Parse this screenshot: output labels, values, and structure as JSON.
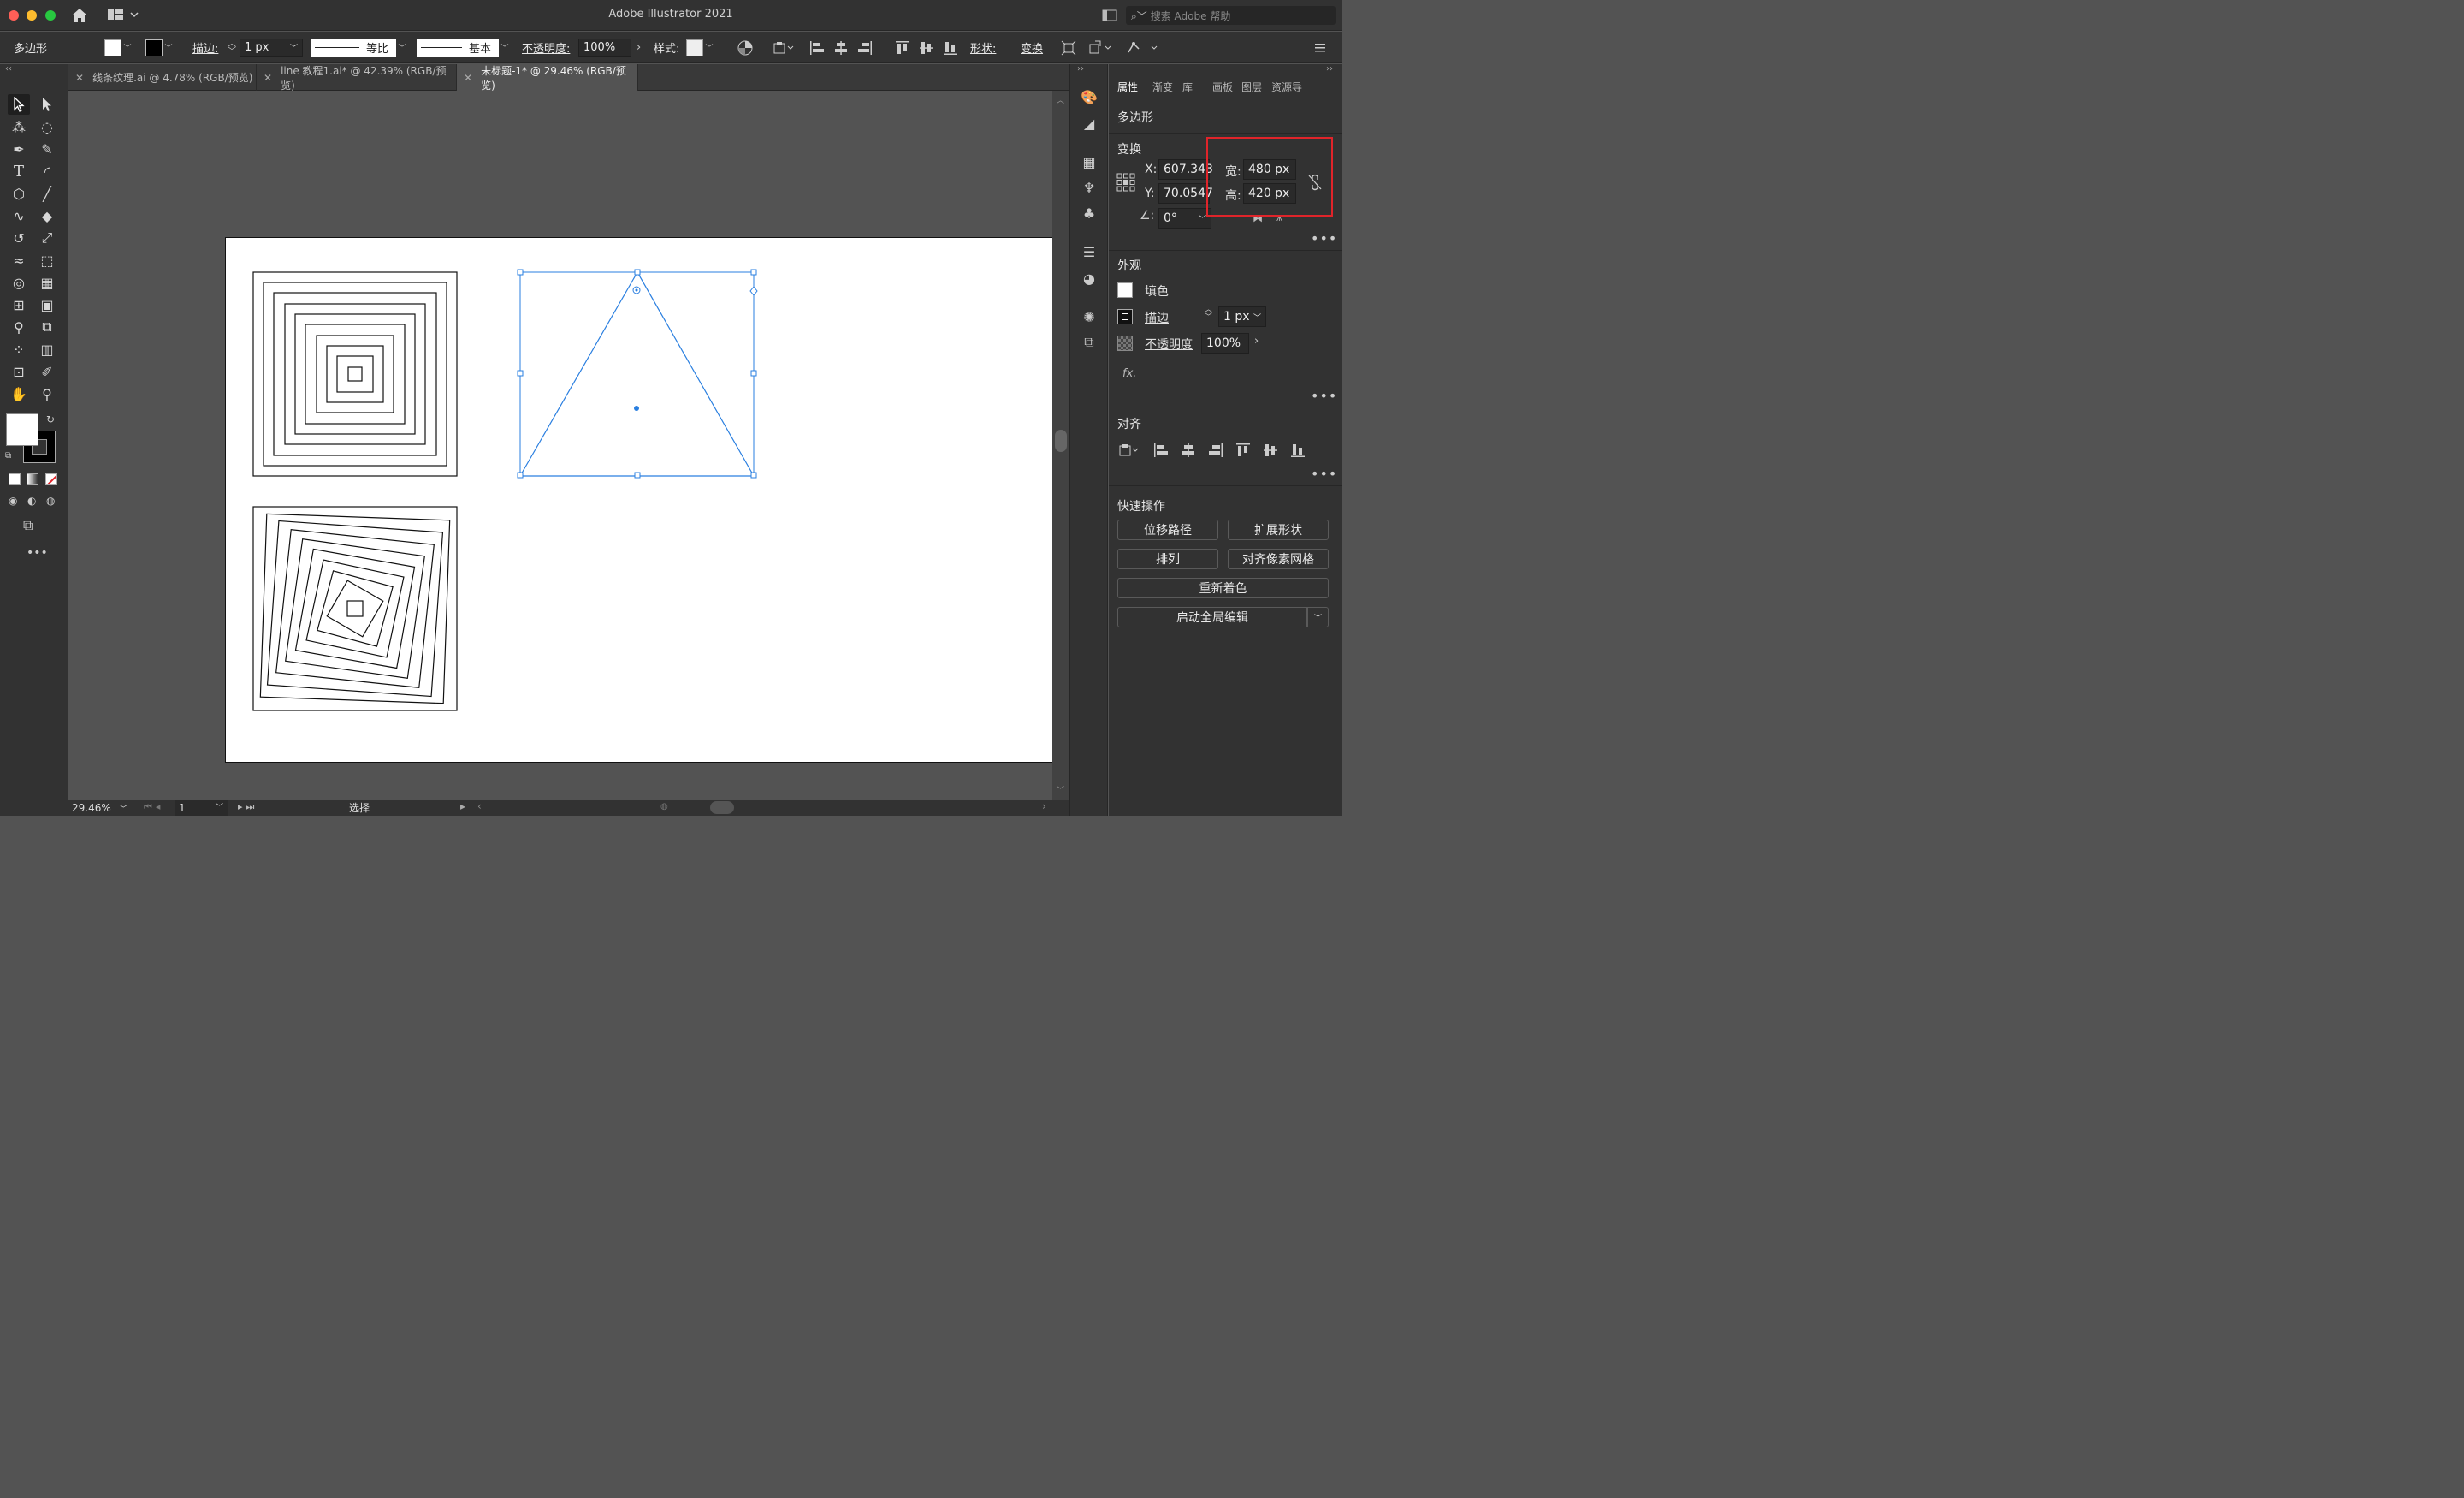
{
  "window": {
    "title": "Adobe Illustrator 2021",
    "search_placeholder": "搜索 Adobe 帮助"
  },
  "controlbar": {
    "object_type": "多边形",
    "stroke_label": "描边:",
    "stroke_weight": "1 px",
    "profile_label": "等比",
    "brush_label": "基本",
    "opacity_label": "不透明度:",
    "opacity_value": "100%",
    "style_label": "样式:",
    "shape_label": "形状:",
    "transform_label": "变换"
  },
  "tabs": [
    {
      "label": "线条纹理.ai @ 4.78% (RGB/预览)",
      "active": false
    },
    {
      "label": "line 教程1.ai* @ 42.39% (RGB/预览)",
      "active": false
    },
    {
      "label": "未标题-1* @ 29.46% (RGB/预览)",
      "active": true
    }
  ],
  "statusbar": {
    "zoom": "29.46%",
    "artboard_number": "1",
    "mode": "选择"
  },
  "panel": {
    "tabs": [
      "属性",
      "渐变",
      "库",
      "画板",
      "图层",
      "资源导"
    ],
    "object_type": "多边形",
    "transform": {
      "title": "变换",
      "x_label": "X:",
      "x_value": "607.343",
      "y_label": "Y:",
      "y_value": "70.0547",
      "w_label": "宽:",
      "w_value": "480 px",
      "h_label": "高:",
      "h_value": "420 px",
      "angle_value": "0°"
    },
    "appearance": {
      "title": "外观",
      "fill_label": "填色",
      "stroke_label": "描边",
      "stroke_value": "1 px",
      "opacity_label": "不透明度",
      "opacity_value": "100%",
      "fx_label": "fx."
    },
    "align": {
      "title": "对齐"
    },
    "quick_actions": {
      "title": "快速操作",
      "offset_path": "位移路径",
      "expand_shape": "扩展形状",
      "arrange": "排列",
      "align_pixel": "对齐像素网格",
      "recolor": "重新着色",
      "global_edit": "启动全局编辑"
    }
  },
  "colors": {
    "selection": "#2a7fe0",
    "highlight": "#e0242a"
  }
}
